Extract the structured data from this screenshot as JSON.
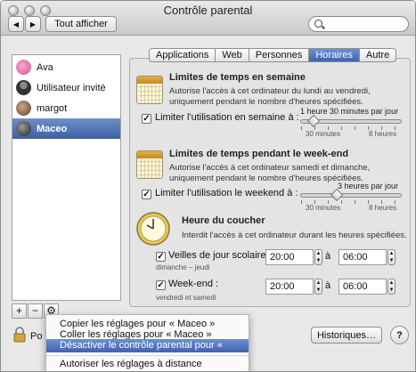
{
  "window": {
    "title": "Contrôle parental",
    "show_all": "Tout afficher"
  },
  "users": [
    {
      "name": "Ava",
      "color": "#d9559a"
    },
    {
      "name": "Utilisateur invité",
      "color": "#5a5a5a"
    },
    {
      "name": "margot",
      "color": "#8d6f58"
    },
    {
      "name": "Maceo",
      "color": "#3a3a3a"
    }
  ],
  "sidebar_buttons": {
    "add": "+",
    "remove": "−",
    "action": "⚙"
  },
  "tabs": [
    {
      "label": "Applications"
    },
    {
      "label": "Web"
    },
    {
      "label": "Personnes"
    },
    {
      "label": "Horaires",
      "active": true
    },
    {
      "label": "Autre"
    }
  ],
  "weekday": {
    "title": "Limites de temps en semaine",
    "desc1": "Autorise l'accès à cet ordinateur du lundi au vendredi,",
    "desc2": "uniquement pendant le nombre d'heures spécifiées.",
    "checkbox_label": "Limiter l'utilisation en semaine à :",
    "value": "1 heure 30 minutes par jour",
    "min": "30 minutes",
    "max": "8 heures",
    "fraction": 0.13
  },
  "weekend": {
    "title": "Limites de temps pendant le week-end",
    "desc1": "Autorise l'accès à cet ordinateur samedi et dimanche,",
    "desc2": "uniquement pendant le nombre d'heures spécifiées.",
    "checkbox_label": "Limiter l'utilisation le weekend à :",
    "value": "3 heures par jour",
    "min": "30 minutes",
    "max": "8 heures",
    "fraction": 0.36
  },
  "bedtime": {
    "title": "Heure du coucher",
    "desc": "Interdit l'accès à cet ordinateur durant les heures spécifiées.",
    "school": {
      "label": "Veilles de jour scolaire :",
      "sub": "dimanche – jeudi",
      "from": "20:00",
      "to": "06:00"
    },
    "weekend": {
      "label": "Week-end :",
      "sub": "vendredi et samedi",
      "from": "20:00",
      "to": "06:00"
    },
    "to_word": "à"
  },
  "bottom": {
    "lock_text": "Po",
    "history": "Historiques…"
  },
  "menu": [
    "Copier les réglages pour « Maceo »",
    "Coller les réglages pour « Maceo »",
    "Désactiver le contrôle parental pour « Maceo »",
    "Autoriser les réglages à distance"
  ],
  "checkmark": "✓"
}
